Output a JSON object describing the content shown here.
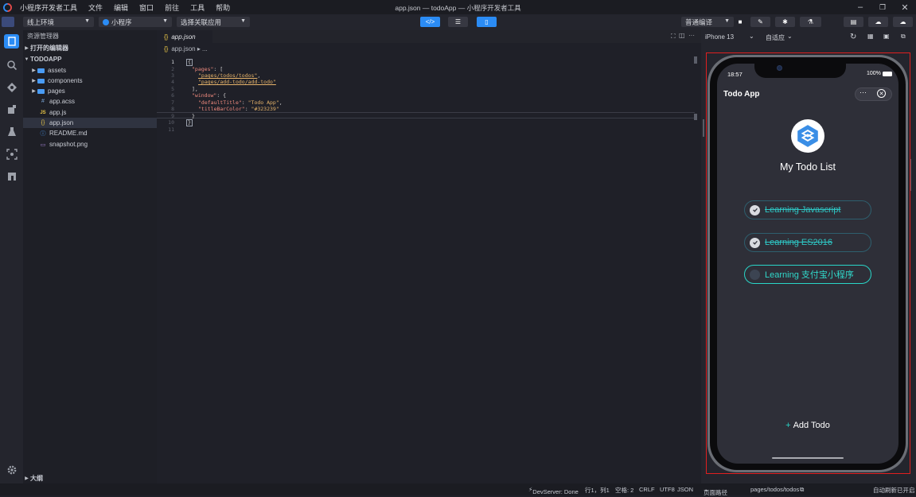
{
  "titlebar": {
    "app_name": "小程序开发者工具",
    "menus": [
      "文件",
      "编辑",
      "窗口",
      "前往",
      "工具",
      "帮助"
    ],
    "window_title": "app.json — todoApp — 小程序开发者工具"
  },
  "toolbar": {
    "env_select": "线上环境",
    "project_type": "小程序",
    "related_app": "选择关联应用",
    "compile_mode": "普通编译"
  },
  "explorer": {
    "header": "资源管理器",
    "open_editors": "打开的编辑器",
    "project": "TODOAPP",
    "folders": [
      "assets",
      "components",
      "pages"
    ],
    "files": [
      {
        "name": "app.acss",
        "icon": "#",
        "color": "#7aa7d8"
      },
      {
        "name": "app.js",
        "icon": "JS",
        "color": "#e8c547"
      },
      {
        "name": "app.json",
        "icon": "{}",
        "color": "#e8c547"
      },
      {
        "name": "README.md",
        "icon": "ⓘ",
        "color": "#4a9cf5"
      },
      {
        "name": "snapshot.png",
        "icon": "▭",
        "color": "#a884d8"
      }
    ],
    "outline": "大纲"
  },
  "editor": {
    "tab": "app.json",
    "breadcrumb": "app.json ▸ ...",
    "line_numbers": [
      "1",
      "2",
      "3",
      "4",
      "5",
      "6",
      "7",
      "8",
      "9",
      "10",
      "11"
    ],
    "code": {
      "l1": "{",
      "pages_key": "\"pages\"",
      "p1": "\"pages/todos/todos\"",
      "p2": "\"pages/add-todo/add-todo\"",
      "close_arr": "],",
      "window_key": "\"window\"",
      "dt_key": "\"defaultTitle\"",
      "dt_val": "\"Todo App\"",
      "tb_key": "\"titleBarColor\"",
      "tb_val": "\"#323239\"",
      "close_obj": "}",
      "l10": "}"
    }
  },
  "simulator": {
    "device": "iPhone 13",
    "fit": "自适应",
    "time": "18:57",
    "battery": "100%",
    "nav_title": "Todo App",
    "more": "···",
    "heading": "My Todo List",
    "todos": [
      {
        "text": "Learning Javascript",
        "done": true
      },
      {
        "text": "Learning ES2016",
        "done": true
      },
      {
        "text": "Learning 支付宝小程序",
        "done": false
      }
    ],
    "add_label": "Add Todo"
  },
  "statusbar": {
    "devserver": "DevServer: Done",
    "position": "行1，列1",
    "indent": "空格: 2",
    "eol": "CRLF",
    "encoding": "UTF8",
    "language": "JSON",
    "page_path_label": "页面路径",
    "page_path": "pages/todos/todos",
    "auto_refresh": "自动刷新已开启"
  },
  "colors": {
    "accent": "#2b8cf5",
    "todo_accent": "#29d6c8",
    "frame": "#e01f1f"
  }
}
